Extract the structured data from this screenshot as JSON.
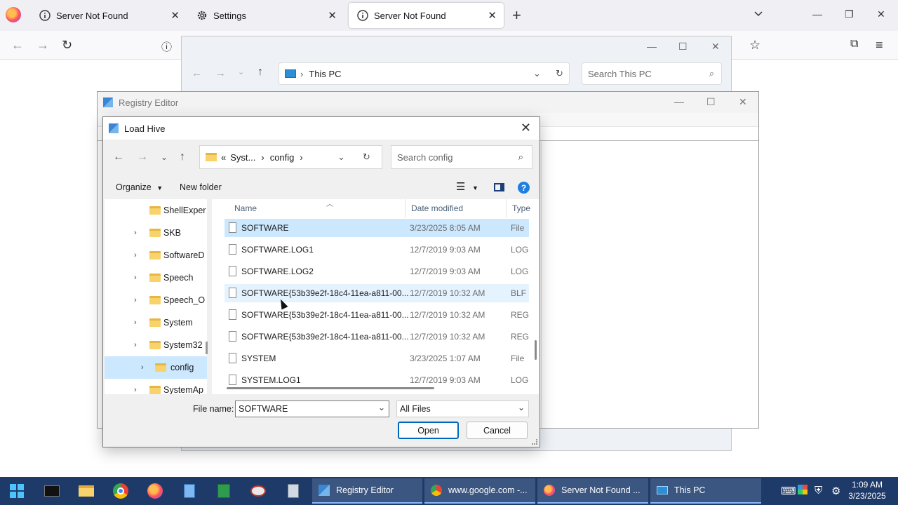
{
  "browser": {
    "tabs": [
      {
        "label": "Server Not Found"
      },
      {
        "label": "Settings"
      },
      {
        "label": "Server Not Found"
      }
    ]
  },
  "explorer": {
    "address": "This PC",
    "search_placeholder": "Search This PC"
  },
  "regedit": {
    "title": "Registry Editor"
  },
  "dialog": {
    "title": "Load Hive",
    "path_prefix": "«",
    "path": [
      "Syst...",
      "config"
    ],
    "search_placeholder": "Search config",
    "toolbar": {
      "organize": "Organize",
      "new_folder": "New folder"
    },
    "tree": [
      {
        "label": "ShellExper",
        "expandable": false
      },
      {
        "label": "SKB",
        "expandable": true
      },
      {
        "label": "SoftwareD",
        "expandable": true
      },
      {
        "label": "Speech",
        "expandable": true
      },
      {
        "label": "Speech_O",
        "expandable": true
      },
      {
        "label": "System",
        "expandable": true
      },
      {
        "label": "System32",
        "expandable": true
      },
      {
        "label": "config",
        "expandable": true,
        "selected": true
      },
      {
        "label": "SystemAp",
        "expandable": true
      }
    ],
    "columns": {
      "name": "Name",
      "date": "Date modified",
      "type": "Type"
    },
    "files": [
      {
        "name": "SOFTWARE",
        "date": "3/23/2025 8:05 AM",
        "type": "File",
        "selected": true
      },
      {
        "name": "SOFTWARE.LOG1",
        "date": "12/7/2019 9:03 AM",
        "type": "LOG"
      },
      {
        "name": "SOFTWARE.LOG2",
        "date": "12/7/2019 9:03 AM",
        "type": "LOG"
      },
      {
        "name": "SOFTWARE{53b39e2f-18c4-11ea-a811-00...",
        "date": "12/7/2019 10:32 AM",
        "type": "BLF F",
        "hover": true
      },
      {
        "name": "SOFTWARE{53b39e2f-18c4-11ea-a811-00...",
        "date": "12/7/2019 10:32 AM",
        "type": "REGT"
      },
      {
        "name": "SOFTWARE{53b39e2f-18c4-11ea-a811-00...",
        "date": "12/7/2019 10:32 AM",
        "type": "REGT"
      },
      {
        "name": "SYSTEM",
        "date": "3/23/2025 1:07 AM",
        "type": "File"
      },
      {
        "name": "SYSTEM.LOG1",
        "date": "12/7/2019 9:03 AM",
        "type": "LOG"
      }
    ],
    "file_name_label": "File name:",
    "file_name_value": "SOFTWARE",
    "file_type": "All Files",
    "open_label": "Open",
    "cancel_label": "Cancel"
  },
  "taskbar": {
    "windows": [
      {
        "label": "Registry Editor"
      },
      {
        "label": "www.google.com -..."
      },
      {
        "label": "Server Not Found ..."
      },
      {
        "label": "This PC"
      }
    ],
    "clock": {
      "time": "1:09 AM",
      "date": "3/23/2025"
    }
  },
  "colors": {
    "accent": "#0067c0",
    "selection": "#cce8ff",
    "taskbar": "#1e3a68"
  }
}
